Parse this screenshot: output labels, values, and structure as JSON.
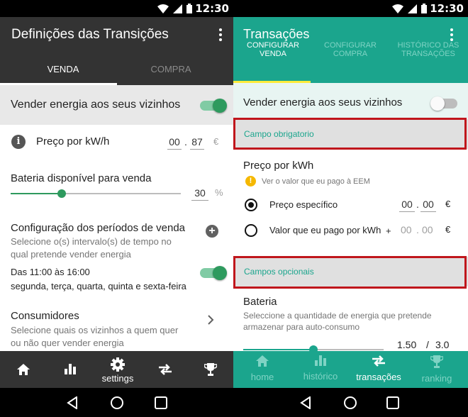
{
  "colors": {
    "left_appbar": "#333333",
    "left_accent_green": "#2e9a5e",
    "right_appbar": "#1ba58d",
    "right_tab_indicator": "#ffeb3b",
    "highlight_box": "#c0161c",
    "section_label": "#1ba58d",
    "info_badge": "#f5b800"
  },
  "status_bar": {
    "time": "12:30"
  },
  "left": {
    "title": "Definições das Transições",
    "tabs": [
      {
        "label": "VENDA",
        "active": true
      },
      {
        "label": "COMPRA",
        "active": false
      }
    ],
    "sell_toggle": {
      "label": "Vender energia aos seus vizinhos",
      "on": true
    },
    "price": {
      "label": "Preço por kW/h",
      "whole": "00",
      "separator": ".",
      "cents": "87",
      "currency": "€"
    },
    "battery": {
      "label": "Bateria disponível para venda",
      "value": "30",
      "unit": "%",
      "slider_fraction": 0.3
    },
    "periods": {
      "title": "Configuração dos períodos de venda",
      "description_line1": "Selecione o(s) intervalo(s) de tempo no",
      "description_line2": "qual pretende vender energia",
      "interval_time": "Das 11:00 às 16:00",
      "interval_days": "segunda, terça, quarta, quinta e sexta-feira",
      "interval_on": true
    },
    "consumers": {
      "title": "Consumidores",
      "description_line1": "Selecione quais os vizinhos a quem quer",
      "description_line2": "ou não quer vender energia"
    },
    "bottom_nav": [
      {
        "icon": "home-icon",
        "label": ""
      },
      {
        "icon": "bar-chart-icon",
        "label": ""
      },
      {
        "icon": "gear-icon",
        "label": "settings"
      },
      {
        "icon": "swap-arrows-icon",
        "label": ""
      },
      {
        "icon": "trophy-icon",
        "label": ""
      }
    ]
  },
  "right": {
    "title": "Transações",
    "tabs": [
      {
        "line1": "CONFIGURAR",
        "line2": "VENDA",
        "active": true
      },
      {
        "line1": "CONFIGURAR",
        "line2": "COMPRA",
        "active": false
      },
      {
        "line1": "HISTÓRICO DAS",
        "line2": "TRANSAÇÕES",
        "active": false
      }
    ],
    "sell_toggle": {
      "label": "Vender energia aos seus vizinhos",
      "on": false
    },
    "required_section": "Campo obrigatorio",
    "price": {
      "title": "Preço por kWh",
      "hint": "Ver o valor que eu pago à EEM",
      "option_specific": {
        "label": "Preço específico",
        "whole": "00",
        "separator": ".",
        "cents": "00",
        "currency": "€",
        "selected": true
      },
      "option_paid": {
        "label": "Valor que eu pago por kWh",
        "prefix": "+",
        "whole": "00",
        "separator": ".",
        "cents": "00",
        "currency": "€",
        "selected": false
      }
    },
    "optional_section": "Campos opcionais",
    "battery": {
      "title": "Bateria",
      "description_line1": "Seleccione a quantidade de energia que pretende",
      "description_line2": "armazenar para auto-consumo",
      "value": "1.50",
      "separator": "/",
      "max": "3.0",
      "slider_fraction": 0.5
    },
    "bottom_nav": [
      {
        "icon": "home-icon",
        "label": "home",
        "active": false
      },
      {
        "icon": "bar-chart-icon",
        "label": "histórico",
        "active": false
      },
      {
        "icon": "swap-arrows-icon",
        "label": "transações",
        "active": true
      },
      {
        "icon": "trophy-icon",
        "label": "ranking",
        "active": false
      }
    ]
  }
}
